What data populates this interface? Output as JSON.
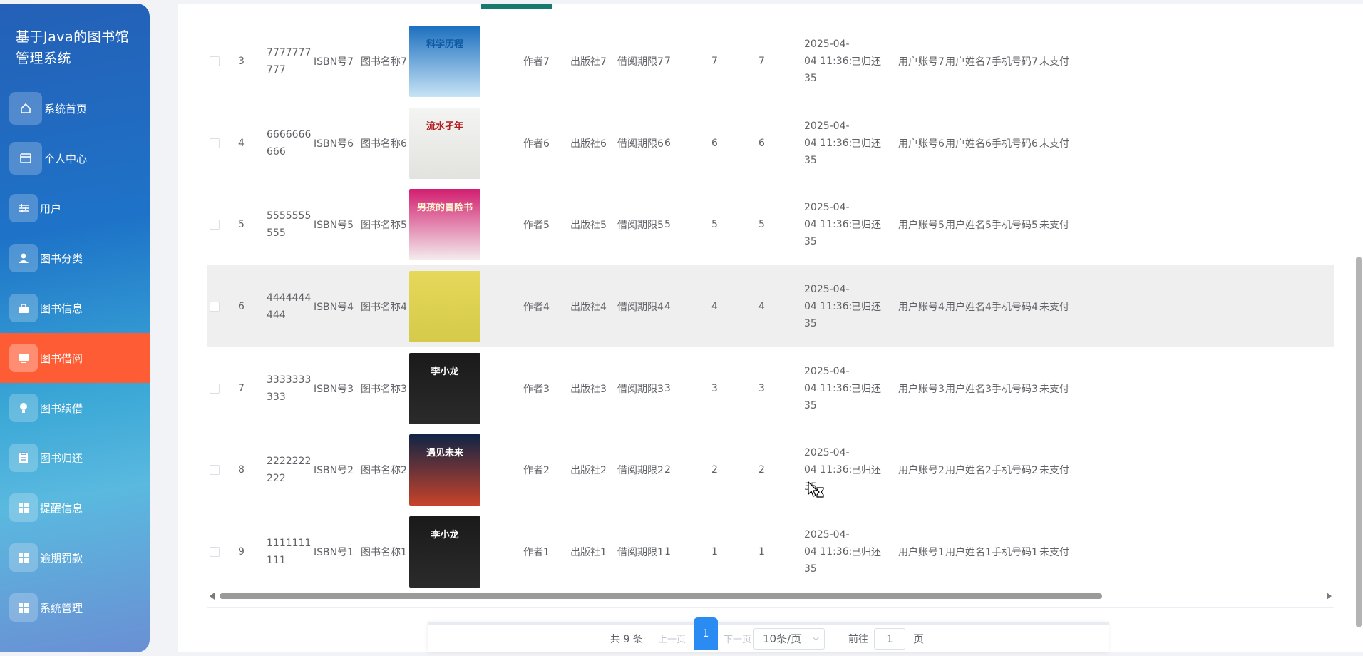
{
  "sidebar": {
    "title": "基于Java的图书馆管理系统",
    "items": [
      {
        "label": "系统首页",
        "icon": "home-icon"
      },
      {
        "label": "个人中心",
        "icon": "profile-card-icon"
      },
      {
        "label": "用户",
        "icon": "sliders-icon"
      },
      {
        "label": "图书分类",
        "icon": "person-icon"
      },
      {
        "label": "图书信息",
        "icon": "briefcase-icon"
      },
      {
        "label": "图书借阅",
        "icon": "monitor-icon"
      },
      {
        "label": "图书续借",
        "icon": "lightbulb-icon"
      },
      {
        "label": "图书归还",
        "icon": "clipboard-icon"
      },
      {
        "label": "提醒信息",
        "icon": "grid-icon"
      },
      {
        "label": "逾期罚款",
        "icon": "grid-icon"
      },
      {
        "label": "系统管理",
        "icon": "grid-icon"
      }
    ],
    "active_index": 5
  },
  "table": {
    "rows": [
      {
        "index": "3",
        "code": "7777777777",
        "isbn": "ISBN号7",
        "name": "图书名称7",
        "author": "作者7",
        "publisher": "出版社7",
        "period": "借阅期限7",
        "n1": "7",
        "n2": "7",
        "n3": "7",
        "date": "2025-04-04 11:36:35",
        "status": "已归还",
        "account": "用户账号7",
        "username": "用户姓名7",
        "phone": "手机号码7",
        "pay": "未支付"
      },
      {
        "index": "4",
        "code": "6666666666",
        "isbn": "ISBN号6",
        "name": "图书名称6",
        "author": "作者6",
        "publisher": "出版社6",
        "period": "借阅期限6",
        "n1": "6",
        "n2": "6",
        "n3": "6",
        "date": "2025-04-04 11:36:35",
        "status": "已归还",
        "account": "用户账号6",
        "username": "用户姓名6",
        "phone": "手机号码6",
        "pay": "未支付"
      },
      {
        "index": "5",
        "code": "5555555555",
        "isbn": "ISBN号5",
        "name": "图书名称5",
        "author": "作者5",
        "publisher": "出版社5",
        "period": "借阅期限5",
        "n1": "5",
        "n2": "5",
        "n3": "5",
        "date": "2025-04-04 11:36:35",
        "status": "已归还",
        "account": "用户账号5",
        "username": "用户姓名5",
        "phone": "手机号码5",
        "pay": "未支付"
      },
      {
        "index": "6",
        "code": "4444444444",
        "isbn": "ISBN号4",
        "name": "图书名称4",
        "author": "作者4",
        "publisher": "出版社4",
        "period": "借阅期限4",
        "n1": "4",
        "n2": "4",
        "n3": "4",
        "date": "2025-04-04 11:36:35",
        "status": "已归还",
        "account": "用户账号4",
        "username": "用户姓名4",
        "phone": "手机号码4",
        "pay": "未支付"
      },
      {
        "index": "7",
        "code": "3333333333",
        "isbn": "ISBN号3",
        "name": "图书名称3",
        "author": "作者3",
        "publisher": "出版社3",
        "period": "借阅期限3",
        "n1": "3",
        "n2": "3",
        "n3": "3",
        "date": "2025-04-04 11:36:35",
        "status": "已归还",
        "account": "用户账号3",
        "username": "用户姓名3",
        "phone": "手机号码3",
        "pay": "未支付"
      },
      {
        "index": "8",
        "code": "2222222222",
        "isbn": "ISBN号2",
        "name": "图书名称2",
        "author": "作者2",
        "publisher": "出版社2",
        "period": "借阅期限2",
        "n1": "2",
        "n2": "2",
        "n3": "2",
        "date": "2025-04-04 11:36:35",
        "status": "已归还",
        "account": "用户账号2",
        "username": "用户姓名2",
        "phone": "手机号码2",
        "pay": "未支付"
      },
      {
        "index": "9",
        "code": "1111111111",
        "isbn": "ISBN号1",
        "name": "图书名称1",
        "author": "作者1",
        "publisher": "出版社1",
        "period": "借阅期限1",
        "n1": "1",
        "n2": "1",
        "n3": "1",
        "date": "2025-04-04 11:36:35",
        "status": "已归还",
        "account": "用户账号1",
        "username": "用户姓名1",
        "phone": "手机号码1",
        "pay": "未支付"
      }
    ],
    "covers": [
      {
        "top": "#1b6fbf",
        "bottom": "#c7e3f5",
        "title": "科学历程",
        "title_color": "#0f5aa5"
      },
      {
        "top": "#f4f4f2",
        "bottom": "#e2e2df",
        "title": "流水孑年",
        "title_color": "#b21f1f"
      },
      {
        "top": "#d21e6f",
        "bottom": "#f3eded",
        "title": "男孩的冒险书",
        "title_color": "#fff7d0"
      },
      {
        "top": "#e5d85a",
        "bottom": "#d6ca4a",
        "title": "",
        "title_color": "#333333"
      },
      {
        "top": "#1a1a1a",
        "bottom": "#2b2b2b",
        "title": "李小龙",
        "title_color": "#ffffff"
      },
      {
        "top": "#0f2445",
        "bottom": "#c7432a",
        "title": "遇见未来",
        "title_color": "#ffffff"
      },
      {
        "top": "#1a1a1a",
        "bottom": "#2b2b2b",
        "title": "李小龙",
        "title_color": "#ffffff"
      }
    ],
    "hover_row": 3
  },
  "pagination": {
    "total": "共 9 条",
    "prev": "上一页",
    "current": "1",
    "next": "下一页",
    "page_size": "10条/页",
    "goto_label": "前往",
    "goto_value": "1",
    "page_unit": "页"
  },
  "colors": {
    "active_menu": "#fe5c34",
    "page_active": "#2a8bf2"
  }
}
